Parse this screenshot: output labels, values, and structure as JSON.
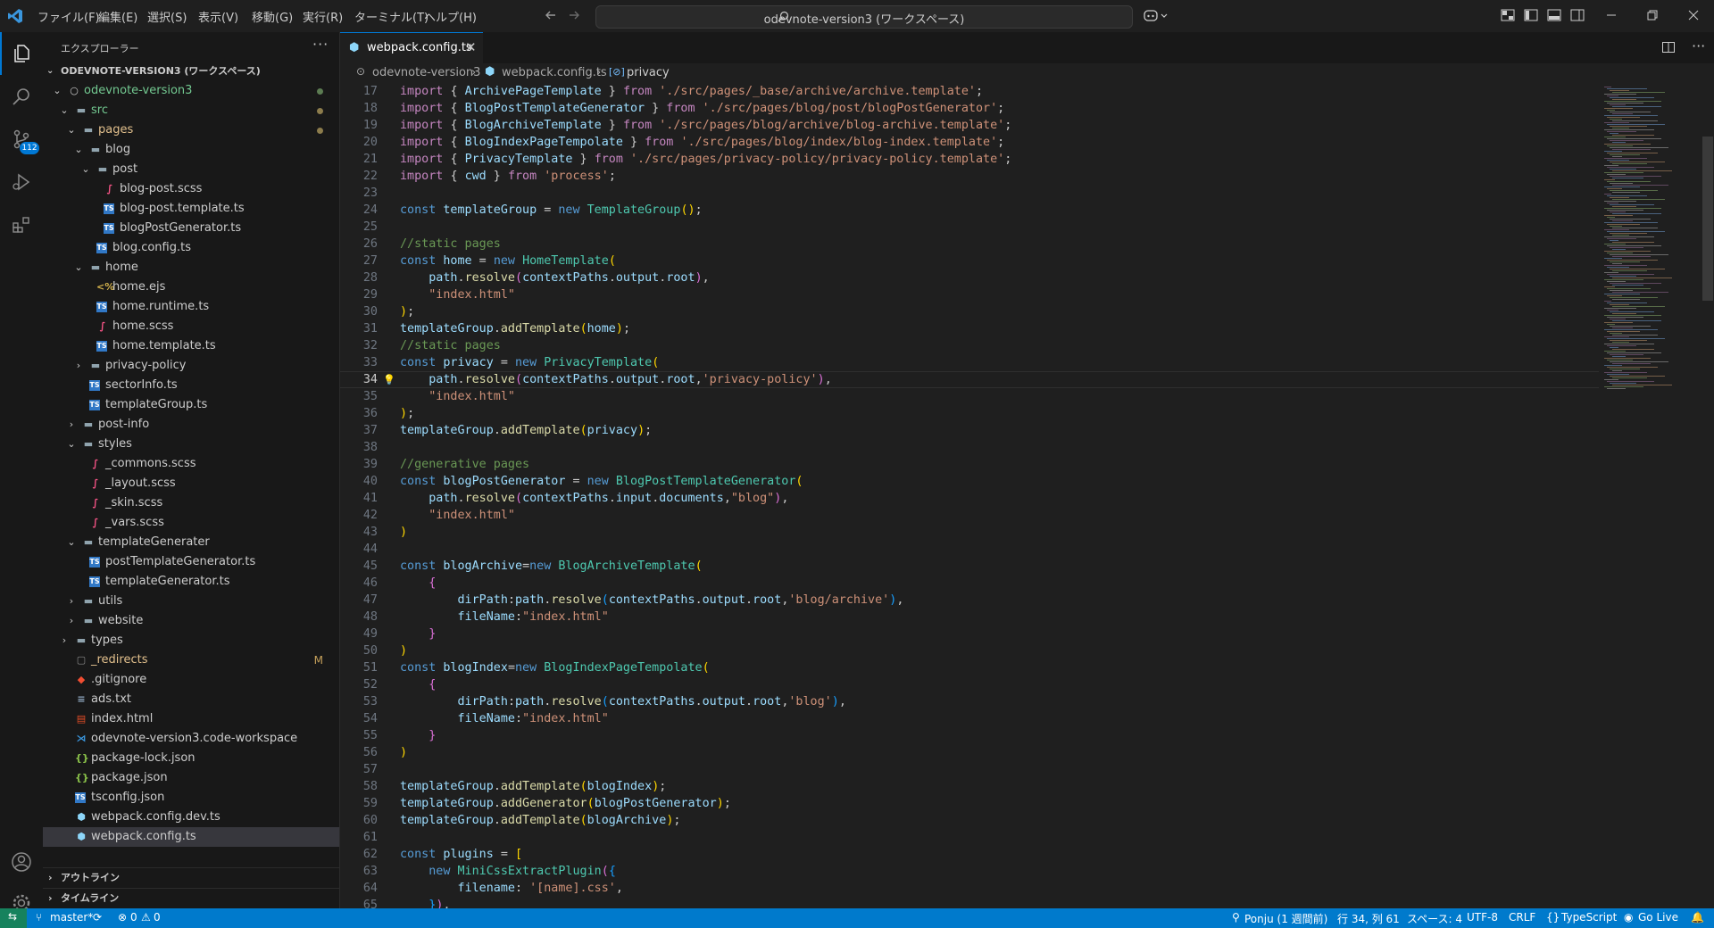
{
  "titlebar": {
    "menus": [
      "ファイル(F)",
      "編集(E)",
      "選択(S)",
      "表示(V)",
      "移動(G)",
      "実行(R)",
      "ターミナル(T)",
      "ヘルプ(H)"
    ],
    "search_text": "odevnote-version3 (ワークスペース)"
  },
  "activity": {
    "scm_badge": "112"
  },
  "sidebar": {
    "title": "エクスプローラー",
    "workspace": "ODEVNOTE-VERSION3 (ワークスペース)",
    "tree": [
      {
        "label": "odevnote-version3",
        "depth": 0,
        "type": "folder-root",
        "color": "#73c991",
        "deco": "dot-green"
      },
      {
        "label": "src",
        "depth": 1,
        "type": "folder",
        "color": "#73c991",
        "deco": "dot-yellow"
      },
      {
        "label": "pages",
        "depth": 2,
        "type": "folder",
        "color": "#e2c08d",
        "deco": "dot-yellow"
      },
      {
        "label": "blog",
        "depth": 3,
        "type": "folder"
      },
      {
        "label": "post",
        "depth": 4,
        "type": "folder"
      },
      {
        "label": "blog-post.scss",
        "depth": 5,
        "type": "scss"
      },
      {
        "label": "blog-post.template.ts",
        "depth": 5,
        "type": "ts"
      },
      {
        "label": "blogPostGenerator.ts",
        "depth": 5,
        "type": "ts"
      },
      {
        "label": "blog.config.ts",
        "depth": 4,
        "type": "ts"
      },
      {
        "label": "home",
        "depth": 3,
        "type": "folder"
      },
      {
        "label": "home.ejs",
        "depth": 4,
        "type": "ejs"
      },
      {
        "label": "home.runtime.ts",
        "depth": 4,
        "type": "ts"
      },
      {
        "label": "home.scss",
        "depth": 4,
        "type": "scss"
      },
      {
        "label": "home.template.ts",
        "depth": 4,
        "type": "ts"
      },
      {
        "label": "privacy-policy",
        "depth": 3,
        "type": "folder-closed"
      },
      {
        "label": "sectorInfo.ts",
        "depth": 3,
        "type": "ts"
      },
      {
        "label": "templateGroup.ts",
        "depth": 3,
        "type": "ts"
      },
      {
        "label": "post-info",
        "depth": 2,
        "type": "folder-closed"
      },
      {
        "label": "styles",
        "depth": 2,
        "type": "folder"
      },
      {
        "label": "_commons.scss",
        "depth": 3,
        "type": "scss"
      },
      {
        "label": "_layout.scss",
        "depth": 3,
        "type": "scss"
      },
      {
        "label": "_skin.scss",
        "depth": 3,
        "type": "scss"
      },
      {
        "label": "_vars.scss",
        "depth": 3,
        "type": "scss"
      },
      {
        "label": "templateGenerater",
        "depth": 2,
        "type": "folder"
      },
      {
        "label": "postTemplateGenerator.ts",
        "depth": 3,
        "type": "ts"
      },
      {
        "label": "templateGenerator.ts",
        "depth": 3,
        "type": "ts"
      },
      {
        "label": "utils",
        "depth": 2,
        "type": "folder-closed"
      },
      {
        "label": "website",
        "depth": 2,
        "type": "folder-closed"
      },
      {
        "label": "types",
        "depth": 1,
        "type": "folder-closed"
      },
      {
        "label": "_redirects",
        "depth": 1,
        "type": "file",
        "color": "#e2c08d",
        "deco": "M"
      },
      {
        "label": ".gitignore",
        "depth": 1,
        "type": "git"
      },
      {
        "label": "ads.txt",
        "depth": 1,
        "type": "txt"
      },
      {
        "label": "index.html",
        "depth": 1,
        "type": "html"
      },
      {
        "label": "odevnote-version3.code-workspace",
        "depth": 1,
        "type": "vscode"
      },
      {
        "label": "package-lock.json",
        "depth": 1,
        "type": "json"
      },
      {
        "label": "package.json",
        "depth": 1,
        "type": "json"
      },
      {
        "label": "tsconfig.json",
        "depth": 1,
        "type": "tsconfig"
      },
      {
        "label": "webpack.config.dev.ts",
        "depth": 1,
        "type": "webpack"
      },
      {
        "label": "webpack.config.ts",
        "depth": 1,
        "type": "webpack",
        "selected": true
      }
    ],
    "outline": "アウトライン",
    "timeline": "タイムライン"
  },
  "editor": {
    "tab_label": "webpack.config.ts",
    "breadcrumb": [
      "odevnote-version3",
      "webpack.config.ts",
      "privacy"
    ],
    "first_line": 17,
    "current_line": 34,
    "lines": [
      [
        [
          "kc",
          "import "
        ],
        [
          "pl",
          "{ "
        ],
        [
          "var",
          "ArchivePageTemplate"
        ],
        [
          "pl",
          " } "
        ],
        [
          "kc",
          "from "
        ],
        [
          "str",
          "'./src/pages/_base/archive/archive.template'"
        ],
        [
          "pl",
          ";"
        ]
      ],
      [
        [
          "kc",
          "import "
        ],
        [
          "pl",
          "{ "
        ],
        [
          "var",
          "BlogPostTemplateGenerator"
        ],
        [
          "pl",
          " } "
        ],
        [
          "kc",
          "from "
        ],
        [
          "str",
          "'./src/pages/blog/post/blogPostGenerator'"
        ],
        [
          "pl",
          ";"
        ]
      ],
      [
        [
          "kc",
          "import "
        ],
        [
          "pl",
          "{ "
        ],
        [
          "var",
          "BlogArchiveTemplate"
        ],
        [
          "pl",
          " } "
        ],
        [
          "kc",
          "from "
        ],
        [
          "str",
          "'./src/pages/blog/archive/blog-archive.template'"
        ],
        [
          "pl",
          ";"
        ]
      ],
      [
        [
          "kc",
          "import "
        ],
        [
          "pl",
          "{ "
        ],
        [
          "var",
          "BlogIndexPageTempolate"
        ],
        [
          "pl",
          " } "
        ],
        [
          "kc",
          "from "
        ],
        [
          "str",
          "'./src/pages/blog/index/blog-index.template'"
        ],
        [
          "pl",
          ";"
        ]
      ],
      [
        [
          "kc",
          "import "
        ],
        [
          "pl",
          "{ "
        ],
        [
          "var",
          "PrivacyTemplate"
        ],
        [
          "pl",
          " } "
        ],
        [
          "kc",
          "from "
        ],
        [
          "str",
          "'./src/pages/privacy-policy/privacy-policy.template'"
        ],
        [
          "pl",
          ";"
        ]
      ],
      [
        [
          "kc",
          "import "
        ],
        [
          "pl",
          "{ "
        ],
        [
          "var",
          "cwd"
        ],
        [
          "pl",
          " } "
        ],
        [
          "kc",
          "from "
        ],
        [
          "str",
          "'process'"
        ],
        [
          "pl",
          ";"
        ]
      ],
      [],
      [
        [
          "kw",
          "const "
        ],
        [
          "var",
          "templateGroup"
        ],
        [
          "pl",
          " = "
        ],
        [
          "kw",
          "new "
        ],
        [
          "cls",
          "TemplateGroup"
        ],
        [
          "br1",
          "()"
        ],
        [
          "pl",
          ";"
        ]
      ],
      [],
      [
        [
          "cm",
          "//static pages"
        ]
      ],
      [
        [
          "kw",
          "const "
        ],
        [
          "var",
          "home"
        ],
        [
          "pl",
          " = "
        ],
        [
          "kw",
          "new "
        ],
        [
          "cls",
          "HomeTemplate"
        ],
        [
          "br1",
          "("
        ]
      ],
      [
        [
          "pl",
          "    "
        ],
        [
          "var",
          "path"
        ],
        [
          "pl",
          "."
        ],
        [
          "fn",
          "resolve"
        ],
        [
          "br2",
          "("
        ],
        [
          "var",
          "contextPaths"
        ],
        [
          "pl",
          "."
        ],
        [
          "var",
          "output"
        ],
        [
          "pl",
          "."
        ],
        [
          "var",
          "root"
        ],
        [
          "br2",
          ")"
        ],
        [
          "pl",
          ","
        ]
      ],
      [
        [
          "pl",
          "    "
        ],
        [
          "str",
          "\"index.html\""
        ]
      ],
      [
        [
          "br1",
          ")"
        ],
        [
          "pl",
          ";"
        ]
      ],
      [
        [
          "var",
          "templateGroup"
        ],
        [
          "pl",
          "."
        ],
        [
          "fn",
          "addTemplate"
        ],
        [
          "br1",
          "("
        ],
        [
          "var",
          "home"
        ],
        [
          "br1",
          ")"
        ],
        [
          "pl",
          ";"
        ]
      ],
      [
        [
          "cm",
          "//static pages"
        ]
      ],
      [
        [
          "kw",
          "const "
        ],
        [
          "var",
          "privacy"
        ],
        [
          "pl",
          " = "
        ],
        [
          "kw",
          "new "
        ],
        [
          "cls",
          "PrivacyTemplate"
        ],
        [
          "br1",
          "("
        ]
      ],
      [
        [
          "pl",
          "    "
        ],
        [
          "var",
          "path"
        ],
        [
          "pl",
          "."
        ],
        [
          "fn",
          "resolve"
        ],
        [
          "br2",
          "("
        ],
        [
          "var",
          "contextPaths"
        ],
        [
          "pl",
          "."
        ],
        [
          "var",
          "output"
        ],
        [
          "pl",
          "."
        ],
        [
          "var",
          "root"
        ],
        [
          "pl",
          ","
        ],
        [
          "str",
          "'privacy-policy'"
        ],
        [
          "br2",
          ")"
        ],
        [
          "pl",
          ","
        ]
      ],
      [
        [
          "pl",
          "    "
        ],
        [
          "str",
          "\"index.html\""
        ]
      ],
      [
        [
          "br1",
          ")"
        ],
        [
          "pl",
          ";"
        ]
      ],
      [
        [
          "var",
          "templateGroup"
        ],
        [
          "pl",
          "."
        ],
        [
          "fn",
          "addTemplate"
        ],
        [
          "br1",
          "("
        ],
        [
          "var",
          "privacy"
        ],
        [
          "br1",
          ")"
        ],
        [
          "pl",
          ";"
        ]
      ],
      [],
      [
        [
          "cm",
          "//generative pages"
        ]
      ],
      [
        [
          "kw",
          "const "
        ],
        [
          "var",
          "blogPostGenerator"
        ],
        [
          "pl",
          " = "
        ],
        [
          "kw",
          "new "
        ],
        [
          "cls",
          "BlogPostTemplateGenerator"
        ],
        [
          "br1",
          "("
        ]
      ],
      [
        [
          "pl",
          "    "
        ],
        [
          "var",
          "path"
        ],
        [
          "pl",
          "."
        ],
        [
          "fn",
          "resolve"
        ],
        [
          "br2",
          "("
        ],
        [
          "var",
          "contextPaths"
        ],
        [
          "pl",
          "."
        ],
        [
          "var",
          "input"
        ],
        [
          "pl",
          "."
        ],
        [
          "var",
          "documents"
        ],
        [
          "pl",
          ","
        ],
        [
          "str",
          "\"blog\""
        ],
        [
          "br2",
          ")"
        ],
        [
          "pl",
          ","
        ]
      ],
      [
        [
          "pl",
          "    "
        ],
        [
          "str",
          "\"index.html\""
        ]
      ],
      [
        [
          "br1",
          ")"
        ]
      ],
      [],
      [
        [
          "kw",
          "const "
        ],
        [
          "var",
          "blogArchive"
        ],
        [
          "pl",
          "="
        ],
        [
          "kw",
          "new "
        ],
        [
          "cls",
          "BlogArchiveTemplate"
        ],
        [
          "br1",
          "("
        ]
      ],
      [
        [
          "pl",
          "    "
        ],
        [
          "br2",
          "{"
        ]
      ],
      [
        [
          "pl",
          "        "
        ],
        [
          "var",
          "dirPath"
        ],
        [
          "pl",
          ":"
        ],
        [
          "var",
          "path"
        ],
        [
          "pl",
          "."
        ],
        [
          "fn",
          "resolve"
        ],
        [
          "br3",
          "("
        ],
        [
          "var",
          "contextPaths"
        ],
        [
          "pl",
          "."
        ],
        [
          "var",
          "output"
        ],
        [
          "pl",
          "."
        ],
        [
          "var",
          "root"
        ],
        [
          "pl",
          ","
        ],
        [
          "str",
          "'blog/archive'"
        ],
        [
          "br3",
          ")"
        ],
        [
          "pl",
          ","
        ]
      ],
      [
        [
          "pl",
          "        "
        ],
        [
          "var",
          "fileName"
        ],
        [
          "pl",
          ":"
        ],
        [
          "str",
          "\"index.html\""
        ]
      ],
      [
        [
          "pl",
          "    "
        ],
        [
          "br2",
          "}"
        ]
      ],
      [
        [
          "br1",
          ")"
        ]
      ],
      [
        [
          "kw",
          "const "
        ],
        [
          "var",
          "blogIndex"
        ],
        [
          "pl",
          "="
        ],
        [
          "kw",
          "new "
        ],
        [
          "cls",
          "BlogIndexPageTempolate"
        ],
        [
          "br1",
          "("
        ]
      ],
      [
        [
          "pl",
          "    "
        ],
        [
          "br2",
          "{"
        ]
      ],
      [
        [
          "pl",
          "        "
        ],
        [
          "var",
          "dirPath"
        ],
        [
          "pl",
          ":"
        ],
        [
          "var",
          "path"
        ],
        [
          "pl",
          "."
        ],
        [
          "fn",
          "resolve"
        ],
        [
          "br3",
          "("
        ],
        [
          "var",
          "contextPaths"
        ],
        [
          "pl",
          "."
        ],
        [
          "var",
          "output"
        ],
        [
          "pl",
          "."
        ],
        [
          "var",
          "root"
        ],
        [
          "pl",
          ","
        ],
        [
          "str",
          "'blog'"
        ],
        [
          "br3",
          ")"
        ],
        [
          "pl",
          ","
        ]
      ],
      [
        [
          "pl",
          "        "
        ],
        [
          "var",
          "fileName"
        ],
        [
          "pl",
          ":"
        ],
        [
          "str",
          "\"index.html\""
        ]
      ],
      [
        [
          "pl",
          "    "
        ],
        [
          "br2",
          "}"
        ]
      ],
      [
        [
          "br1",
          ")"
        ]
      ],
      [],
      [
        [
          "var",
          "templateGroup"
        ],
        [
          "pl",
          "."
        ],
        [
          "fn",
          "addTemplate"
        ],
        [
          "br1",
          "("
        ],
        [
          "var",
          "blogIndex"
        ],
        [
          "br1",
          ")"
        ],
        [
          "pl",
          ";"
        ]
      ],
      [
        [
          "var",
          "templateGroup"
        ],
        [
          "pl",
          "."
        ],
        [
          "fn",
          "addGenerator"
        ],
        [
          "br1",
          "("
        ],
        [
          "var",
          "blogPostGenerator"
        ],
        [
          "br1",
          ")"
        ],
        [
          "pl",
          ";"
        ]
      ],
      [
        [
          "var",
          "templateGroup"
        ],
        [
          "pl",
          "."
        ],
        [
          "fn",
          "addTemplate"
        ],
        [
          "br1",
          "("
        ],
        [
          "var",
          "blogArchive"
        ],
        [
          "br1",
          ")"
        ],
        [
          "pl",
          ";"
        ]
      ],
      [],
      [
        [
          "kw",
          "const "
        ],
        [
          "var",
          "plugins"
        ],
        [
          "pl",
          " = "
        ],
        [
          "br1",
          "["
        ]
      ],
      [
        [
          "pl",
          "    "
        ],
        [
          "kw",
          "new "
        ],
        [
          "cls",
          "MiniCssExtractPlugin"
        ],
        [
          "br2",
          "("
        ],
        [
          "br3",
          "{"
        ]
      ],
      [
        [
          "pl",
          "        "
        ],
        [
          "var",
          "filename"
        ],
        [
          "pl",
          ": "
        ],
        [
          "str",
          "'[name].css'"
        ],
        [
          "pl",
          ","
        ]
      ],
      [
        [
          "pl",
          "    "
        ],
        [
          "br3",
          "}"
        ],
        [
          "br2",
          ")"
        ],
        [
          "pl",
          ","
        ]
      ]
    ]
  },
  "statusbar": {
    "branch": "master*",
    "problems": "0",
    "warnings": "0",
    "author": "Ponju (1 週間前)",
    "position": "行 34, 列 61",
    "spaces": "スペース: 4",
    "encoding": "UTF-8",
    "eol": "CRLF",
    "language": "TypeScript",
    "golive": "Go Live"
  },
  "colors": {
    "accent": "#007acc",
    "folder_git": "#73c991",
    "modified": "#e2c08d"
  }
}
